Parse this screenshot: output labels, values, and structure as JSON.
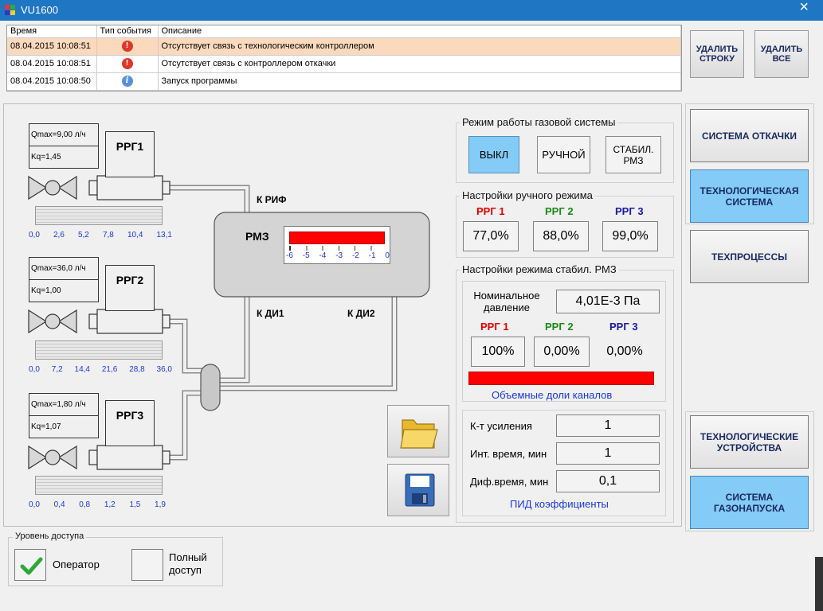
{
  "window": {
    "title": "VU1600"
  },
  "events": {
    "columns": {
      "time": "Время",
      "type": "Тип события",
      "desc": "Описание"
    },
    "rows": [
      {
        "time": "08.04.2015 10:08:51",
        "type_icon": "error-icon",
        "desc": "Отсутствует связь с технологическим контроллером"
      },
      {
        "time": "08.04.2015 10:08:51",
        "type_icon": "error-icon",
        "desc": "Отсутствует связь с контроллером откачки"
      },
      {
        "time": "08.04.2015 10:08:50",
        "type_icon": "info-icon",
        "desc": "Запуск программы"
      }
    ],
    "delete_row": "УДАЛИТЬ СТРОКУ",
    "delete_all": "УДАЛИТЬ ВСЕ"
  },
  "nav": {
    "pumping": "СИСТЕМА ОТКАЧКИ",
    "tech_system": "ТЕХНОЛОГИЧЕСКАЯ СИСТЕМА",
    "tech_processes": "ТЕХПРОЦЕССЫ",
    "tech_devices": "ТЕХНОЛОГИЧЕСКИЕ УСТРОЙСТВА",
    "gas_inlet": "СИСТЕМА ГАЗОНАПУСКА"
  },
  "gas_mode": {
    "legend": "Режим работы газовой системы",
    "off": "ВЫКЛ",
    "manual": "РУЧНОЙ",
    "stab": "СТАБИЛ. РМЗ"
  },
  "manual": {
    "legend": "Настройки ручного режима",
    "rrg1": "РРГ 1",
    "rrg2": "РРГ 2",
    "rrg3": "РРГ 3",
    "v1": "77,0%",
    "v2": "88,0%",
    "v3": "99,0%"
  },
  "stab": {
    "legend": "Настройки режима стабил. РМЗ",
    "nominal_label": "Номинальное давление",
    "nominal_value": "4,01Е-3 Па",
    "rrg1": "РРГ 1",
    "rrg2": "РРГ 2",
    "rrg3": "РРГ 3",
    "v1": "100%",
    "v2": "0,00%",
    "v3": "0,00%",
    "fractions_label": "Объемные доли каналов",
    "fractions": [
      1.0,
      0.0,
      0.0
    ]
  },
  "pid": {
    "gain_label": "К-т усиления",
    "gain": "1",
    "int_label": "Инт. время, мин",
    "int": "1",
    "dif_label": "Диф.время, мин",
    "dif": "0,1",
    "footer": "ПИД коэффициенты"
  },
  "diagram": {
    "rrg": [
      {
        "name": "РРГ1",
        "qmax": "Qmax=9,00 л/ч",
        "kq": "Kq=1,45",
        "scale": [
          "0,0",
          "2,6",
          "5,2",
          "7,8",
          "10,4",
          "13,1"
        ]
      },
      {
        "name": "РРГ2",
        "qmax": "Qmax=36,0 л/ч",
        "kq": "Kq=1,00",
        "scale": [
          "0,0",
          "7,2",
          "14,4",
          "21,6",
          "28,8",
          "36,0"
        ]
      },
      {
        "name": "РРГ3",
        "qmax": "Qmax=1,80 л/ч",
        "kq": "Kq=1,07",
        "scale": [
          "0,0",
          "0,4",
          "0,8",
          "1,2",
          "1,5",
          "1,9"
        ]
      }
    ],
    "k_rif": "К РИФ",
    "k_di1": "К ДИ1",
    "k_di2": "К ДИ2",
    "rmz": "РМЗ",
    "rmz_ticks": [
      "-6",
      "-5",
      "-4",
      "-3",
      "-2",
      "-1",
      "0"
    ],
    "rmz_fill": 1.0
  },
  "access": {
    "legend": "Уровень доступа",
    "operator": "Оператор",
    "full": "Полный доступ",
    "operator_checked": true
  },
  "colors": {
    "accent": "#84cbf7",
    "red": "#ff0000"
  }
}
